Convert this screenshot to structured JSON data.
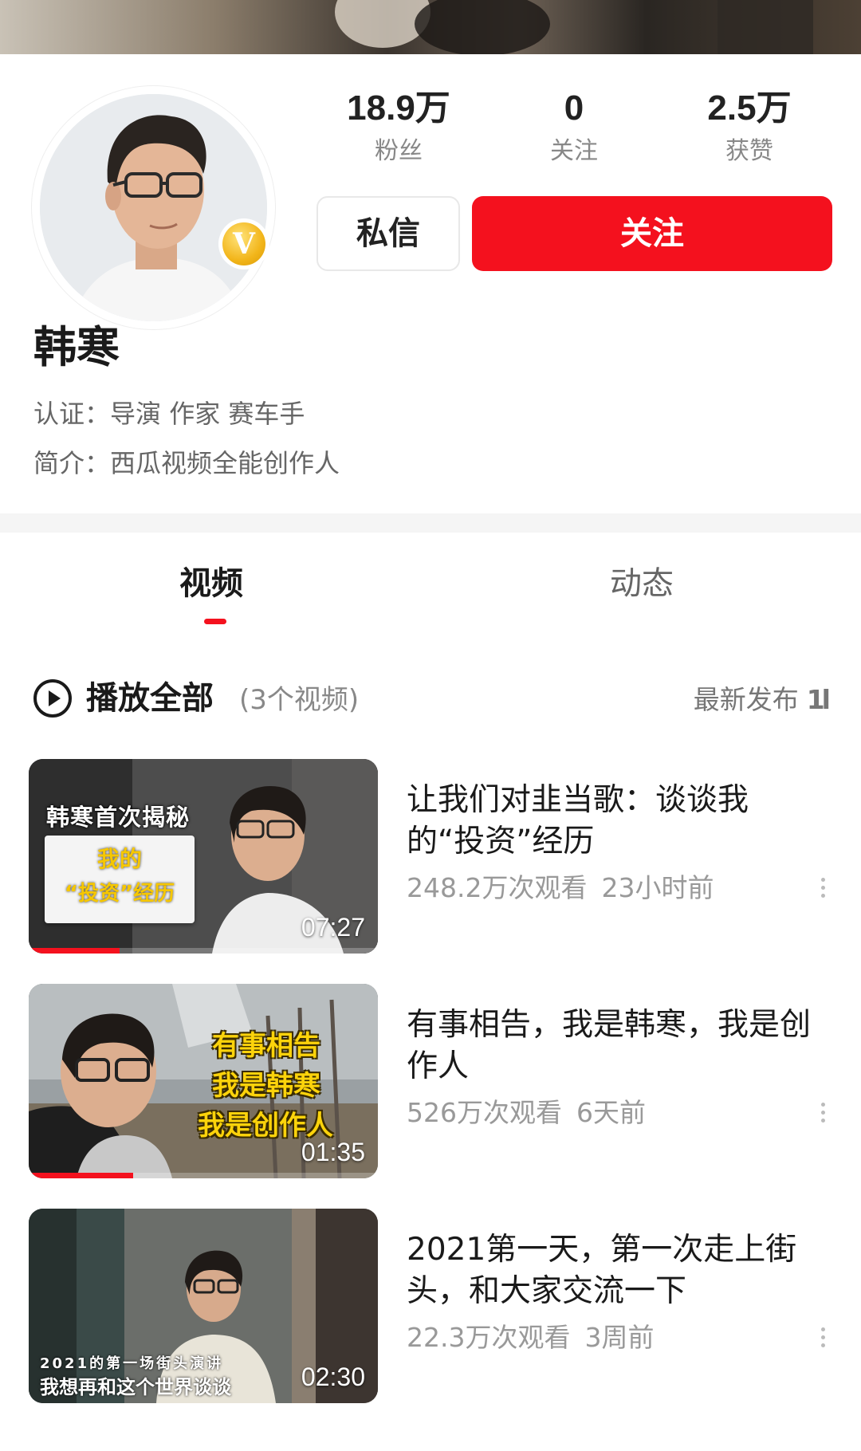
{
  "profile": {
    "name": "韩寒",
    "verified_badge": "V",
    "certification_label": "认证：",
    "certification_value": "导演 作家 赛车手",
    "intro_label": "简介：",
    "intro_value": "西瓜视频全能创作人"
  },
  "stats": [
    {
      "value": "18.9万",
      "label": "粉丝"
    },
    {
      "value": "0",
      "label": "关注"
    },
    {
      "value": "2.5万",
      "label": "获赞"
    }
  ],
  "actions": {
    "message_label": "私信",
    "follow_label": "关注"
  },
  "tabs": [
    {
      "label": "视频",
      "active": true
    },
    {
      "label": "动态",
      "active": false
    }
  ],
  "playlist": {
    "play_all_label": "播放全部",
    "count_label": "(3个视频)",
    "sort_label": "最新发布",
    "sort_icon": "1l"
  },
  "videos": [
    {
      "title": "让我们对韭当歌：谈谈我的“投资”经历",
      "views": "248.2万次观看",
      "time": "23小时前",
      "duration": "07:27",
      "watch_progress": 0.26,
      "thumb_caption_top": "韩寒首次揭秘",
      "thumb_card_line1": "我的",
      "thumb_card_line2": "“投资”经历"
    },
    {
      "title": "有事相告，我是韩寒，我是创作人",
      "views": "526万次观看",
      "time": "6天前",
      "duration": "01:35",
      "watch_progress": 0.3,
      "thumb_lines": [
        "有事相告",
        "我是韩寒",
        "我是创作人"
      ]
    },
    {
      "title": "2021第一天，第一次走上街头，和大家交流一下",
      "views": "22.3万次观看",
      "time": "3周前",
      "duration": "02:30",
      "watch_progress": 0,
      "thumb_bottom_line1": "2021的第一场街头演讲",
      "thumb_bottom_line2": "我想再和这个世界谈谈"
    }
  ],
  "colors": {
    "accent_red": "#f4111e",
    "badge_gold": "#f2b51a",
    "thumb_caption_yellow": "#fcd30b"
  },
  "icons": {
    "play_all": "play-circle-icon",
    "sort": "sort-icon",
    "more": "more-vertical-icon",
    "verified": "verified-v-icon"
  }
}
